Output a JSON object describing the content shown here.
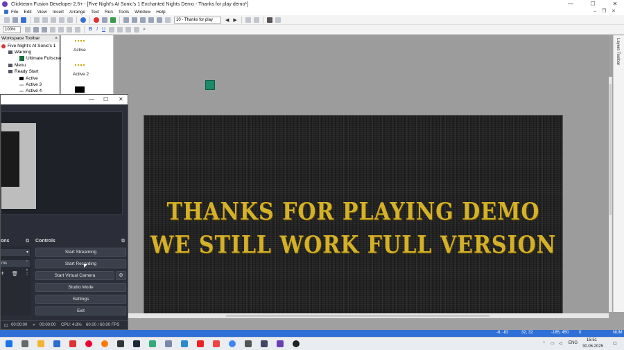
{
  "window": {
    "title": "Clickteam Fusion Developer 2.5+ - [Five Night's At Sonic's 1 Enchanted Nights Demo - Thanks for play demo*]",
    "minimize": "—",
    "maximize": "☐",
    "close": "✕"
  },
  "menu": [
    "File",
    "Edit",
    "View",
    "Insert",
    "Arrange",
    "Text",
    "Run",
    "Tools",
    "Window",
    "Help"
  ],
  "toolbar": {
    "frame_select": "10 - Thanks for play",
    "zoom": "100%",
    "bold": "B",
    "italic": "I",
    "underline": "U"
  },
  "workspace": {
    "title": "Workspace Toolbar",
    "tree": [
      {
        "label": "Five Night's At Sonic's 1"
      },
      {
        "label": "Warning"
      },
      {
        "label": "Ultimate Fullscree"
      },
      {
        "label": "Menu"
      },
      {
        "label": "Ready Start"
      },
      {
        "label": "Active"
      },
      {
        "label": "Active 3"
      },
      {
        "label": "Active 4"
      }
    ]
  },
  "objects": {
    "items": [
      "Active",
      "Active 2"
    ]
  },
  "layers_toolbar": "Layers Toolbar",
  "game_text": {
    "line1": "THANKS FOR PLAYING DEMO",
    "line2": "WE STILL WORK FULL VERSION"
  },
  "statusbar": {
    "coords1": "-6, -82",
    "coords2": "32, 32",
    "coords3": "-185, 450",
    "value": "0",
    "num": "NUM"
  },
  "obs": {
    "close": "✕",
    "maximize": "☐",
    "minimize": "—",
    "left_dock_title": "ons",
    "left_dock_combo": "ms",
    "controls_title": "Controls",
    "buttons": {
      "start_streaming": "Start Streaming",
      "start_recording": "Start Recording",
      "start_virtual_camera": "Start Virtual Camera",
      "studio_mode": "Studio Mode",
      "settings": "Settings",
      "exit": "Exit"
    },
    "status": {
      "time1": "00:00:00",
      "time2": "00:00:00",
      "cpu": "CPU: 4.8%",
      "fps": "60.00 / 60.00 FPS"
    }
  },
  "taskbar": {
    "lang": "ENG",
    "time": "15:51",
    "date": "30.06.2025"
  }
}
